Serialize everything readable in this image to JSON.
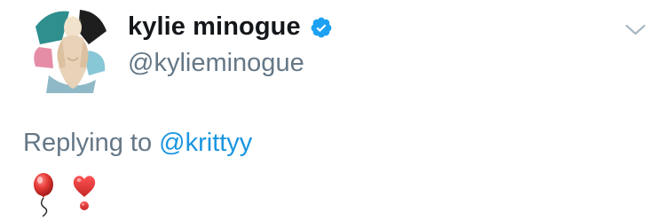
{
  "tweet": {
    "display_name": "kylie minogue",
    "handle": "@kylieminogue",
    "verified": true,
    "reply_prefix": "Replying to",
    "reply_mention": "@krittyy",
    "emojis": [
      "balloon-emoji",
      "heavy-heart-exclamation-emoji"
    ]
  },
  "icons": {
    "verified": "verified-badge-icon",
    "menu": "chevron-down-icon"
  },
  "colors": {
    "name_text": "#14171a",
    "secondary_text": "#657786",
    "link": "#1b95e0",
    "verified_badge": "#1da1f2"
  }
}
